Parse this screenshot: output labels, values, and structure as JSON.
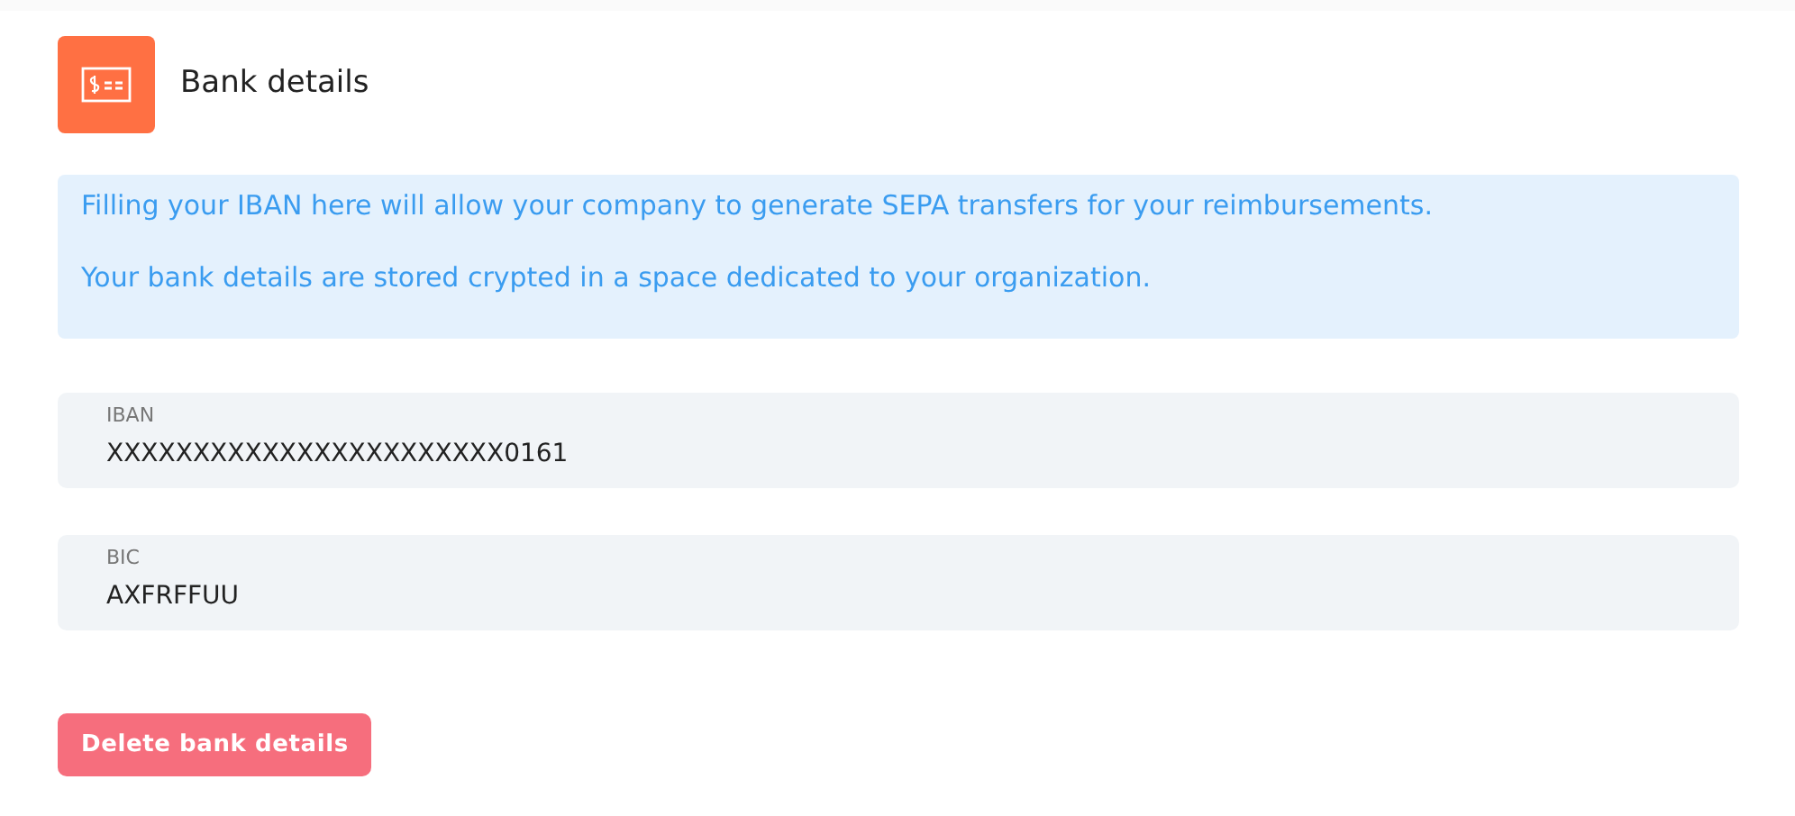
{
  "header": {
    "title": "Bank details"
  },
  "info": [
    "Filling your IBAN here will allow your company to generate SEPA transfers for your reimbursements.",
    "Your bank details are stored crypted in a space dedicated to your organization."
  ],
  "fields": [
    {
      "label": "IBAN",
      "value": "XXXXXXXXXXXXXXXXXXXXXXX0161"
    },
    {
      "label": "BIC",
      "value": "AXFRFFUU"
    }
  ],
  "delete_button": "Delete bank details"
}
